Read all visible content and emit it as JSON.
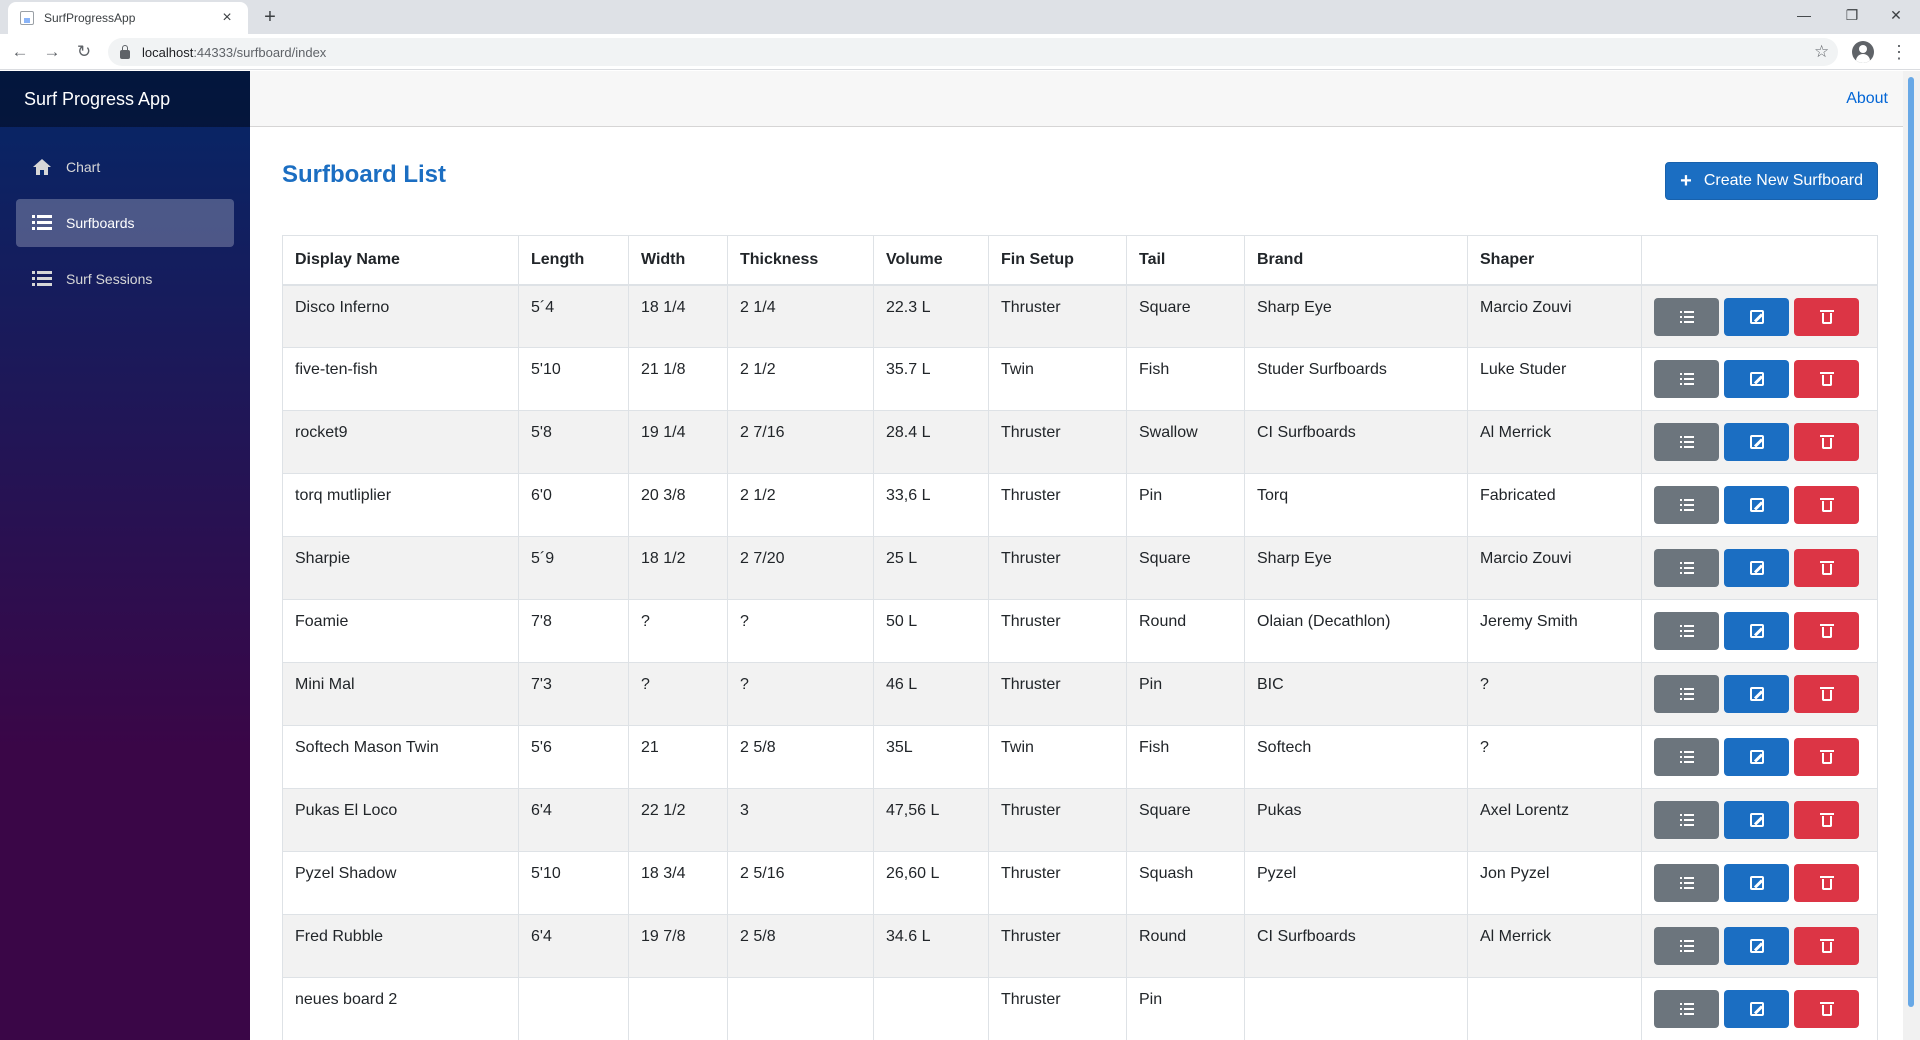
{
  "browser": {
    "tab_title": "SurfProgressApp",
    "tab_close": "×",
    "new_tab": "+",
    "url_host": "localhost",
    "url_path": ":44333/surfboard/index",
    "minimize": "—",
    "restore": "❐",
    "close": "✕"
  },
  "app": {
    "brand": "Surf Progress App",
    "about": "About"
  },
  "sidebar": {
    "items": [
      {
        "label": "Chart",
        "icon": "home-icon"
      },
      {
        "label": "Surfboards",
        "icon": "list-icon",
        "active": true
      },
      {
        "label": "Surf Sessions",
        "icon": "list-icon"
      }
    ]
  },
  "page": {
    "title": "Surfboard List",
    "create_button": "Create New Surfboard"
  },
  "table": {
    "headers": [
      "Display Name",
      "Length",
      "Width",
      "Thickness",
      "Volume",
      "Fin Setup",
      "Tail",
      "Brand",
      "Shaper"
    ],
    "rows": [
      [
        "Disco Inferno",
        "5´4",
        "18 1/4",
        "2 1/4",
        "22.3 L",
        "Thruster",
        "Square",
        "Sharp Eye",
        "Marcio Zouvi"
      ],
      [
        "five-ten-fish",
        "5'10",
        "21 1/8",
        "2 1/2",
        "35.7 L",
        "Twin",
        "Fish",
        "Studer Surfboards",
        "Luke Studer"
      ],
      [
        "rocket9",
        "5'8",
        "19 1/4",
        "2 7/16",
        "28.4 L",
        "Thruster",
        "Swallow",
        "CI Surfboards",
        "Al Merrick"
      ],
      [
        "torq mutliplier",
        "6'0",
        "20 3/8",
        "2 1/2",
        "33,6 L",
        "Thruster",
        "Pin",
        "Torq",
        "Fabricated"
      ],
      [
        "Sharpie",
        "5´9",
        "18 1/2",
        "2 7/20",
        "25 L",
        "Thruster",
        "Square",
        "Sharp Eye",
        "Marcio Zouvi"
      ],
      [
        "Foamie",
        "7'8",
        "?",
        "?",
        "50 L",
        "Thruster",
        "Round",
        "Olaian (Decathlon)",
        "Jeremy Smith"
      ],
      [
        "Mini Mal",
        "7'3",
        "?",
        "?",
        "46 L",
        "Thruster",
        "Pin",
        "BIC",
        "?"
      ],
      [
        "Softech Mason Twin",
        "5'6",
        "21",
        "2 5/8",
        "35L",
        "Twin",
        "Fish",
        "Softech",
        "?"
      ],
      [
        "Pukas El Loco",
        "6'4",
        "22 1/2",
        "3",
        "47,56 L",
        "Thruster",
        "Square",
        "Pukas",
        "Axel Lorentz"
      ],
      [
        "Pyzel Shadow",
        "5'10",
        "18 3/4",
        "2 5/16",
        "26,60 L",
        "Thruster",
        "Squash",
        "Pyzel",
        "Jon Pyzel"
      ],
      [
        "Fred Rubble",
        "6'4",
        "19 7/8",
        "2 5/8",
        "34.6 L",
        "Thruster",
        "Round",
        "CI Surfboards",
        "Al Merrick"
      ],
      [
        "neues board 2",
        "",
        "",
        "",
        "",
        "Thruster",
        "Pin",
        "",
        ""
      ]
    ]
  },
  "colors": {
    "primary": "#1b6ec2",
    "secondary": "#6c757d",
    "danger": "#dc3545"
  }
}
